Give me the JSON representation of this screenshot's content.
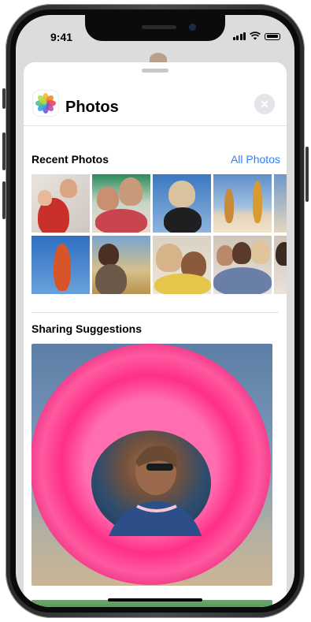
{
  "status_bar": {
    "time": "9:41"
  },
  "sheet": {
    "app_icon": "photos-app-icon",
    "app_name": "Photos",
    "close_icon": "close-icon",
    "recent": {
      "title": "Recent Photos",
      "link": "All Photos",
      "thumb_count": 10
    },
    "sharing": {
      "title": "Sharing Suggestions"
    }
  },
  "colors": {
    "accent": "#2d7ff9",
    "ring": "#ff2f88"
  }
}
